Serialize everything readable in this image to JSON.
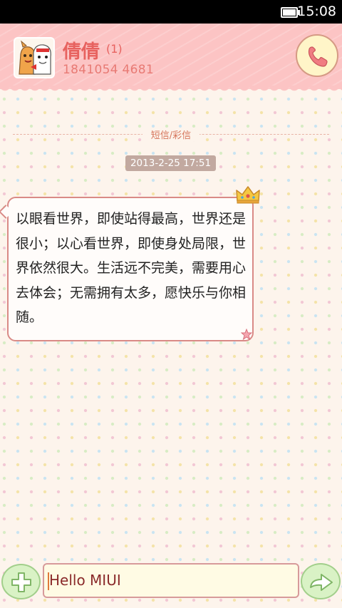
{
  "status_bar": {
    "time": "15:08",
    "battery_icon": "battery-icon"
  },
  "header": {
    "contact_name": "倩倩",
    "unread_count": "(1)",
    "contact_phone": "1841054 4681",
    "avatar_icon": "avatar-image",
    "call_icon": "phone-icon"
  },
  "thread": {
    "divider_label": "短信/彩信",
    "timestamp": "2013-2-25 17:51",
    "message_text": "以眼看世界，即使站得最高，世界还是很小；以心看世界，即使身处局限，世界依然很大。生活远不完美，需要用心去体会；无需拥有太多，愿快乐与你相随。",
    "decorations": [
      "crown-icon",
      "star-icon"
    ]
  },
  "compose": {
    "input_value": "Hello MIUI",
    "add_icon": "plus-icon",
    "send_icon": "send-arrow-icon"
  },
  "colors": {
    "header_bg": "#fcc4c4",
    "accent_text": "#e7625f",
    "bubble_border": "#d98a86",
    "button_green": "#d9f2c5"
  }
}
